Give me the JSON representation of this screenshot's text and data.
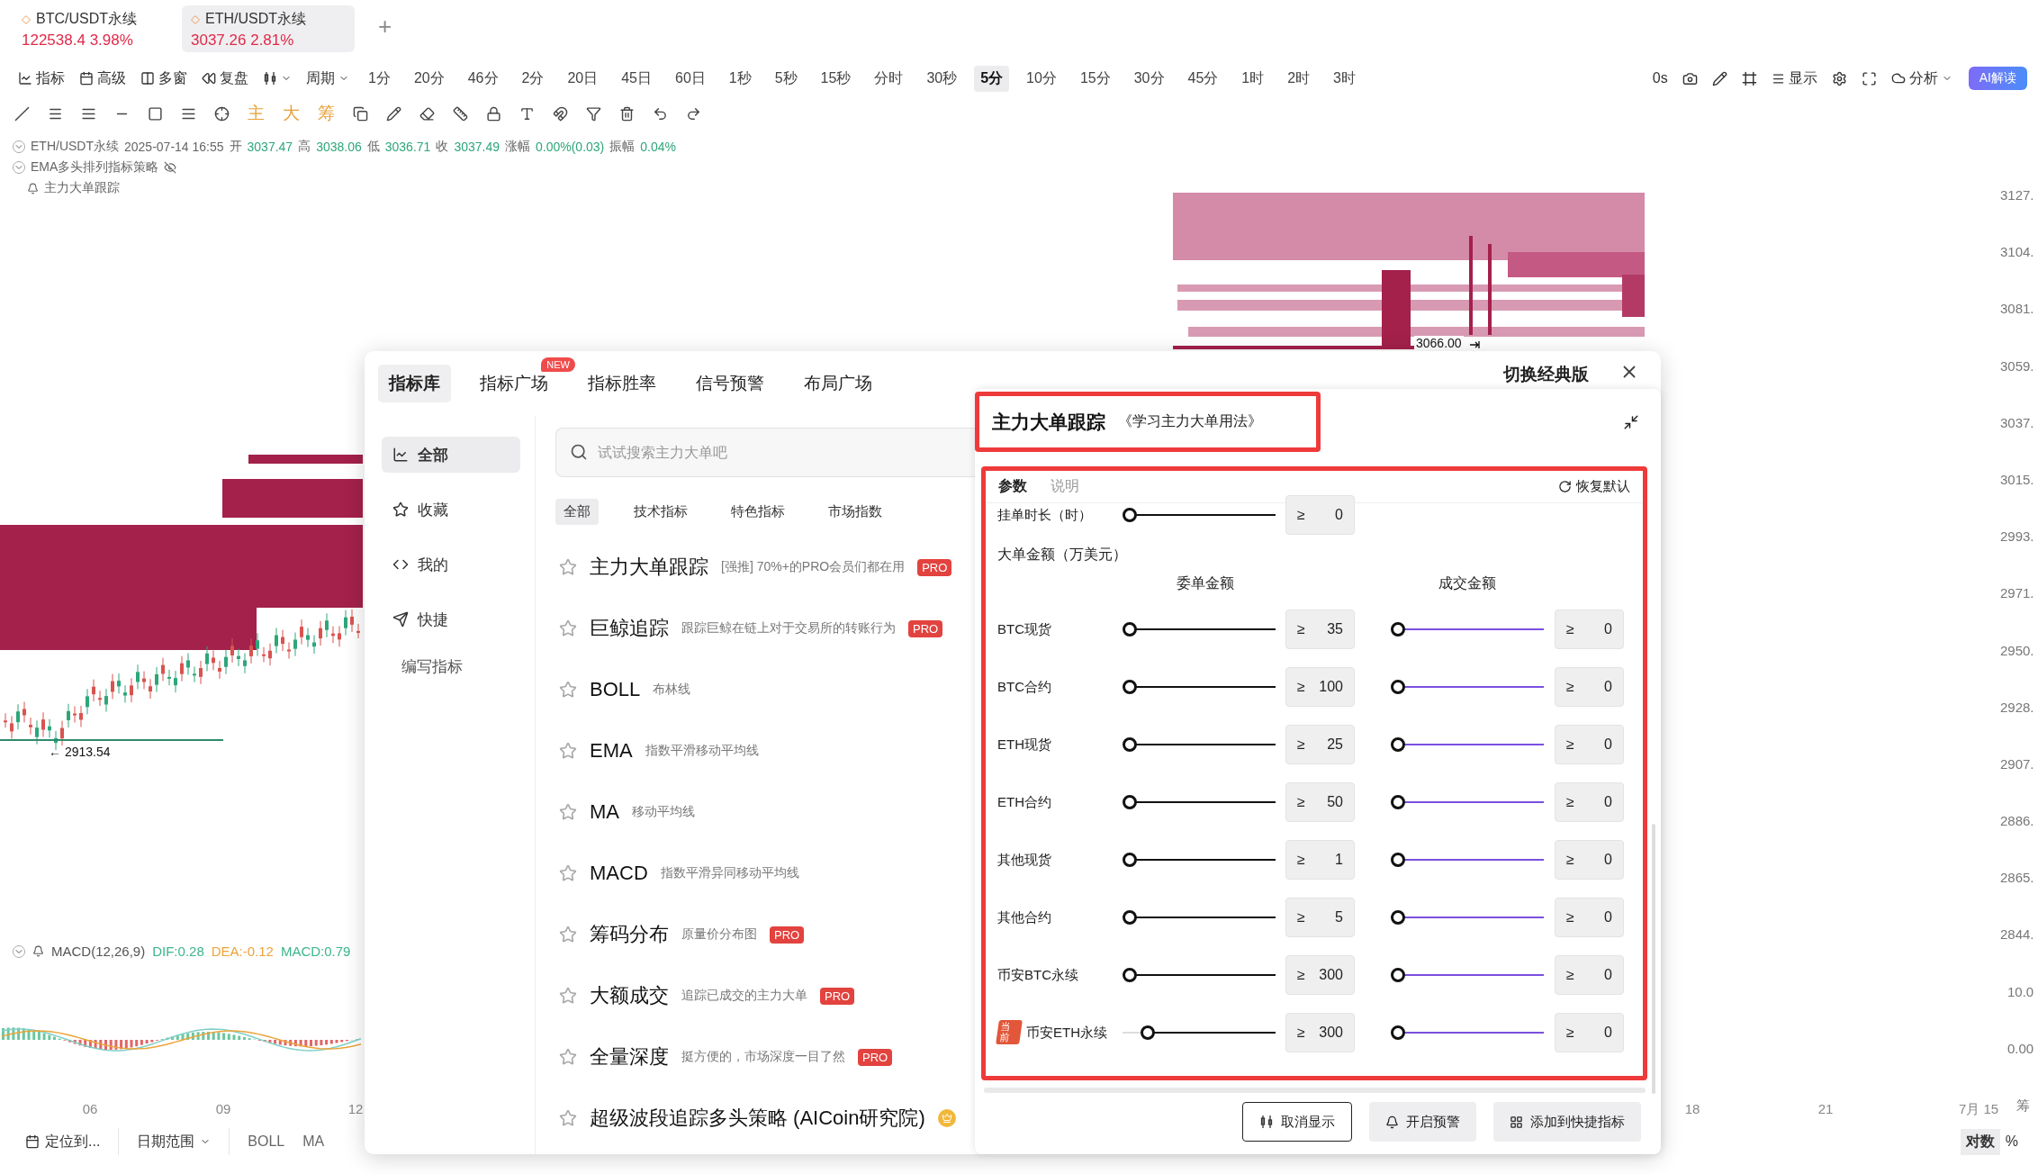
{
  "symbol_tabs": [
    {
      "pair": "BTC/USDT永续",
      "price": "122538.4",
      "change": "3.98%",
      "selected": false
    },
    {
      "pair": "ETH/USDT永续",
      "price": "3037.26",
      "change": "2.81%",
      "selected": true
    }
  ],
  "new_tab": "+",
  "main_tools": [
    {
      "label": "指标"
    },
    {
      "label": "高级"
    },
    {
      "label": "多窗"
    },
    {
      "label": "复盘"
    }
  ],
  "period_menu": "周期",
  "periods": [
    {
      "label": "1分",
      "selected": false
    },
    {
      "label": "20分",
      "selected": false
    },
    {
      "label": "46分",
      "selected": false
    },
    {
      "label": "2分",
      "selected": false
    },
    {
      "label": "20日",
      "selected": false
    },
    {
      "label": "45日",
      "selected": false
    },
    {
      "label": "60日",
      "selected": false
    },
    {
      "label": "1秒",
      "selected": false
    },
    {
      "label": "5秒",
      "selected": false
    },
    {
      "label": "15秒",
      "selected": false
    },
    {
      "label": "分时",
      "selected": false
    },
    {
      "label": "30秒",
      "selected": false
    },
    {
      "label": "5分",
      "selected": true
    },
    {
      "label": "10分",
      "selected": false
    },
    {
      "label": "15分",
      "selected": false
    },
    {
      "label": "30分",
      "selected": false
    },
    {
      "label": "45分",
      "selected": false
    },
    {
      "label": "1时",
      "selected": false
    },
    {
      "label": "2时",
      "selected": false
    },
    {
      "label": "3时",
      "selected": false
    }
  ],
  "right_tools": {
    "timer": "0s",
    "display": "显示",
    "analysis": "分析",
    "ai": "AI解读"
  },
  "draw_marks": [
    "主",
    "大",
    "筹"
  ],
  "legend": {
    "symbol": "ETH/USDT永续",
    "time": "2025-07-14 16:55",
    "fields": [
      {
        "key": "开",
        "value": "3037.47"
      },
      {
        "key": "高",
        "value": "3038.06"
      },
      {
        "key": "低",
        "value": "3036.71"
      },
      {
        "key": "收",
        "value": "3037.49"
      },
      {
        "key": "涨幅",
        "value": "0.00%(0.03)"
      },
      {
        "key": "振幅",
        "value": "0.04%"
      }
    ],
    "strategy": "EMA多头排列指标策略",
    "alert": "主力大单跟踪"
  },
  "macd_legend": {
    "name": "MACD(12,26,9)",
    "values": [
      {
        "text": "DIF:0.28",
        "color": "#3cb58c"
      },
      {
        "text": "DEA:-0.12",
        "color": "#eba43a"
      },
      {
        "text": "MACD:0.79",
        "color": "#3cb58c"
      }
    ]
  },
  "price_marks": {
    "low": "← 2913.54",
    "level": "3066.00"
  },
  "price_axis": [
    "3127.",
    "3104.",
    "3081.",
    "3059.",
    "3037.",
    "3015.",
    "2993.",
    "2971.",
    "2950.",
    "2928.",
    "2907.",
    "2886.",
    "2865.",
    "2844."
  ],
  "macd_axis": [
    "10.0",
    "0.00"
  ],
  "time_axis": [
    "06",
    "09",
    "12",
    "18",
    "21",
    "7月 15"
  ],
  "chip_label": "筹",
  "bottom_bar": {
    "locate": "定位到...",
    "range": "日期范围",
    "indicators": [
      "BOLL",
      "MA"
    ],
    "scale": [
      {
        "label": "对数",
        "selected": true
      },
      {
        "label": "%",
        "selected": false
      }
    ]
  },
  "modal": {
    "tabs": [
      {
        "label": "指标库",
        "selected": true
      },
      {
        "label": "指标广场",
        "selected": false,
        "badge": "NEW"
      },
      {
        "label": "指标胜率",
        "selected": false
      },
      {
        "label": "信号预警",
        "selected": false
      },
      {
        "label": "布局广场",
        "selected": false
      }
    ],
    "switch_label": "切换经典版",
    "sidebar": [
      {
        "label": "全部",
        "selected": true
      },
      {
        "label": "收藏",
        "selected": false
      },
      {
        "label": "我的",
        "selected": false
      },
      {
        "label": "快捷",
        "selected": false
      }
    ],
    "sidebar_action": "编写指标",
    "search": {
      "placeholder": "试试搜索主力大单吧"
    },
    "filters": [
      {
        "label": "全部",
        "selected": true
      },
      {
        "label": "技术指标",
        "selected": false
      },
      {
        "label": "特色指标",
        "selected": false
      },
      {
        "label": "市场指数",
        "selected": false
      }
    ],
    "indicators": [
      {
        "name": "主力大单跟踪",
        "desc": "[强推] 70%+的PRO会员们都在用",
        "kind": "pro",
        "badge": "PRO",
        "starred": false
      },
      {
        "name": "巨鲸追踪",
        "desc": "跟踪巨鲸在链上对于交易所的转账行为",
        "kind": "pro",
        "badge": "PRO",
        "starred": false
      },
      {
        "name": "BOLL",
        "desc": "布林线",
        "kind": "plain",
        "starred": false
      },
      {
        "name": "EMA",
        "desc": "指数平滑移动平均线",
        "kind": "plain",
        "starred": false
      },
      {
        "name": "MA",
        "desc": "移动平均线",
        "kind": "plain",
        "starred": false
      },
      {
        "name": "MACD",
        "desc": "指数平滑异同移动平均线",
        "kind": "plain",
        "starred": false
      },
      {
        "name": "筹码分布",
        "desc": "原量价分布图",
        "kind": "pro",
        "badge": "PRO",
        "starred": false
      },
      {
        "name": "大额成交",
        "desc": "追踪已成交的主力大单",
        "kind": "pro",
        "badge": "PRO",
        "starred": false
      },
      {
        "name": "全量深度",
        "desc": "挺方便的，市场深度一目了然",
        "kind": "pro",
        "badge": "PRO",
        "starred": false
      },
      {
        "name": "超级波段追踪多头策略 (AICoin研究院)",
        "kind": "crown",
        "starred": false
      }
    ],
    "detail": {
      "title": "主力大单跟踪",
      "link": "《学习主力大单用法》",
      "tabs": [
        {
          "label": "参数",
          "selected": true
        },
        {
          "label": "说明",
          "selected": false
        }
      ],
      "reset": "恢复默认",
      "hold": {
        "label": "挂单时长（时）",
        "level": 0,
        "op": "≥",
        "value": "0"
      },
      "amount_title": "大单金额（万美元）",
      "columns": [
        "委单金额",
        "成交金额"
      ],
      "rows": [
        {
          "label": "BTC现货",
          "order": {
            "level": 0,
            "op": "≥",
            "value": "35"
          },
          "trade": {
            "level": 0,
            "op": "≥",
            "value": "0"
          }
        },
        {
          "label": "BTC合约",
          "order": {
            "level": 0,
            "op": "≥",
            "value": "100"
          },
          "trade": {
            "level": 0,
            "op": "≥",
            "value": "0"
          }
        },
        {
          "label": "ETH现货",
          "order": {
            "level": 0,
            "op": "≥",
            "value": "25"
          },
          "trade": {
            "level": 0,
            "op": "≥",
            "value": "0"
          }
        },
        {
          "label": "ETH合约",
          "order": {
            "level": 0,
            "op": "≥",
            "value": "50"
          },
          "trade": {
            "level": 0,
            "op": "≥",
            "value": "0"
          }
        },
        {
          "label": "其他现货",
          "order": {
            "level": 0,
            "op": "≥",
            "value": "1"
          },
          "trade": {
            "level": 0,
            "op": "≥",
            "value": "0"
          }
        },
        {
          "label": "其他合约",
          "order": {
            "level": 0,
            "op": "≥",
            "value": "5"
          },
          "trade": {
            "level": 0,
            "op": "≥",
            "value": "0"
          }
        },
        {
          "label": "币安BTC永续",
          "order": {
            "level": 0,
            "op": "≥",
            "value": "300"
          },
          "trade": {
            "level": 0,
            "op": "≥",
            "value": "0"
          }
        },
        {
          "label": "币安ETH永续",
          "badge": "当前",
          "order": {
            "level": 0.13,
            "op": "≥",
            "value": "300"
          },
          "trade": {
            "level": 0,
            "op": "≥",
            "value": "0"
          }
        }
      ],
      "buttons": [
        {
          "label": "取消显示",
          "kind": "outline"
        },
        {
          "label": "开启预警",
          "kind": "alert"
        },
        {
          "label": "添加到快捷指标",
          "kind": "shortcut"
        }
      ]
    }
  }
}
